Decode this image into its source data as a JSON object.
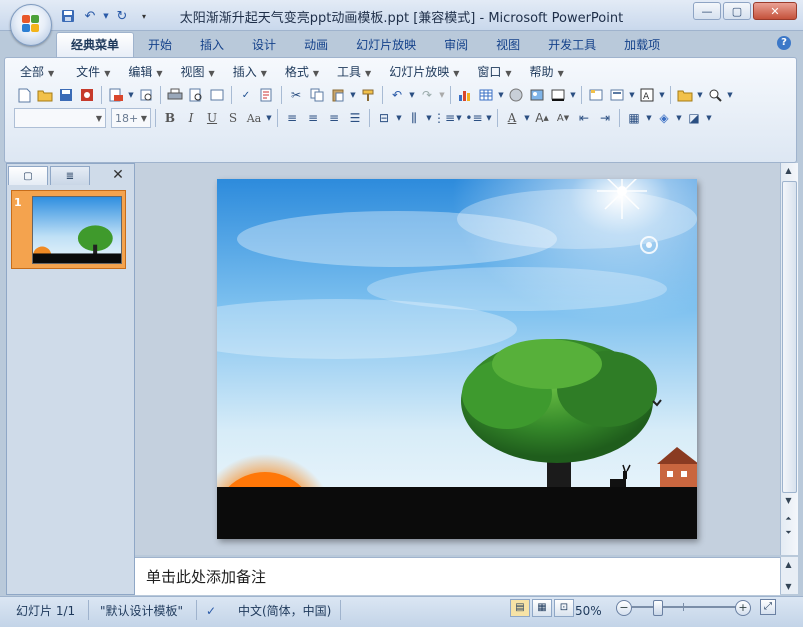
{
  "window": {
    "title": "太阳渐渐升起天气变亮ppt动画模板.ppt [兼容模式] - Microsoft PowerPoint",
    "minimize": "—",
    "maximize": "▢",
    "close": "✕"
  },
  "quick_access": {
    "save_icon": "save-icon",
    "undo_icon": "undo-icon",
    "redo_icon": "redo-icon",
    "customize_icon": "customize-icon"
  },
  "ribbon_tabs": [
    {
      "label": "经典菜单",
      "active": true
    },
    {
      "label": "开始"
    },
    {
      "label": "插入"
    },
    {
      "label": "设计"
    },
    {
      "label": "动画"
    },
    {
      "label": "幻灯片放映"
    },
    {
      "label": "审阅"
    },
    {
      "label": "视图"
    },
    {
      "label": "开发工具"
    },
    {
      "label": "加载项"
    }
  ],
  "menus": [
    "全部",
    "文件",
    "编辑",
    "视图",
    "插入",
    "格式",
    "工具",
    "幻灯片放映",
    "窗口",
    "帮助"
  ],
  "format": {
    "font_size": "18+"
  },
  "slides_pane": {
    "slide_number": "1"
  },
  "notes": {
    "placeholder": "单击此处添加备注"
  },
  "status": {
    "slide": "幻灯片 1/1",
    "theme": "\"默认设计模板\"",
    "language": "中文(简体，中国)",
    "zoom": "50%",
    "zoom_fraction": 0.25
  },
  "colors": {
    "accent": "#f08a24",
    "sky_top": "#2f8fe0",
    "ground": "#0b0b0b",
    "tree": "#3f9a2c"
  }
}
